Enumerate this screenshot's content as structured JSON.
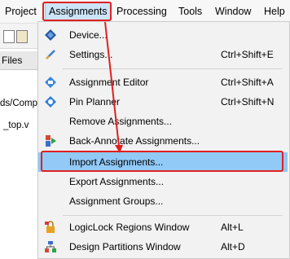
{
  "menubar": {
    "items": [
      {
        "label": "Project"
      },
      {
        "label": "Assignments"
      },
      {
        "label": "Processing"
      },
      {
        "label": "Tools"
      },
      {
        "label": "Window"
      },
      {
        "label": "Help"
      }
    ]
  },
  "background": {
    "files_tab": "Files",
    "path_fragment": "ds/Comp",
    "file_fragment": "_top.v"
  },
  "menu": {
    "items": [
      {
        "label": "Device...",
        "shortcut": "",
        "icon": "device-icon"
      },
      {
        "label": "Settings...",
        "shortcut": "Ctrl+Shift+E",
        "icon": "settings-icon"
      },
      {
        "label": "Assignment Editor",
        "shortcut": "Ctrl+Shift+A",
        "icon": "assignment-editor-icon"
      },
      {
        "label": "Pin Planner",
        "shortcut": "Ctrl+Shift+N",
        "icon": "pin-planner-icon"
      },
      {
        "label": "Remove Assignments...",
        "shortcut": "",
        "icon": ""
      },
      {
        "label": "Back-Annotate Assignments...",
        "shortcut": "",
        "icon": "back-annotate-icon"
      },
      {
        "label": "Import Assignments...",
        "shortcut": "",
        "icon": ""
      },
      {
        "label": "Export Assignments...",
        "shortcut": "",
        "icon": ""
      },
      {
        "label": "Assignment Groups...",
        "shortcut": "",
        "icon": ""
      },
      {
        "label": "LogicLock Regions Window",
        "shortcut": "Alt+L",
        "icon": "logiclock-icon"
      },
      {
        "label": "Design Partitions Window",
        "shortcut": "Alt+D",
        "icon": "design-partitions-icon"
      }
    ],
    "selected_index": 6
  },
  "colors": {
    "highlight_box": "#e02020",
    "selected_item": "#91c9f7",
    "menubar_active": "#cce4f7"
  }
}
